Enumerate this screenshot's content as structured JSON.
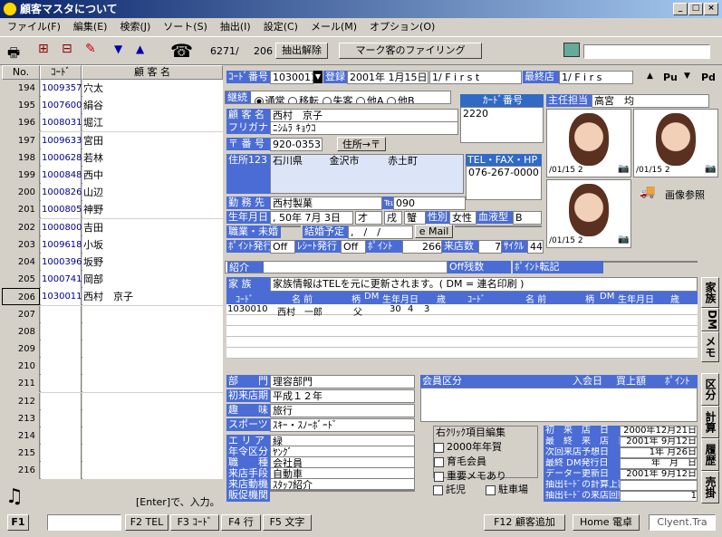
{
  "window": {
    "title": "顧客マスタについて"
  },
  "menu": [
    "ファイル(F)",
    "編集(E)",
    "検索(J)",
    "ソート(S)",
    "抽出(I)",
    "設定(C)",
    "メール(M)",
    "オプション(O)"
  ],
  "toolbar": {
    "count": "6271/",
    "count2": "206",
    "extract_clear": "抽出解除",
    "mark_filing": "マーク客のファイリング"
  },
  "list": {
    "headers": {
      "no": "No.",
      "code": "ｺｰﾄﾞ",
      "name": "顧 客 名"
    },
    "rows": [
      {
        "no": "194",
        "code": "1009357",
        "name": "穴太"
      },
      {
        "no": "195",
        "code": "1007600",
        "name": "絹谷"
      },
      {
        "no": "196",
        "code": "1008031",
        "name": "堀江"
      },
      {
        "no": "197",
        "code": "1009633",
        "name": "宮田"
      },
      {
        "no": "198",
        "code": "1000628",
        "name": "若林"
      },
      {
        "no": "199",
        "code": "1000848",
        "name": "西中"
      },
      {
        "no": "200",
        "code": "1000826",
        "name": "山辺"
      },
      {
        "no": "201",
        "code": "1000805",
        "name": "神野"
      },
      {
        "no": "202",
        "code": "1000800",
        "name": "吉田"
      },
      {
        "no": "203",
        "code": "1009618",
        "name": "小坂"
      },
      {
        "no": "204",
        "code": "1000396",
        "name": "坂野"
      },
      {
        "no": "205",
        "code": "1000741",
        "name": "岡部"
      },
      {
        "no": "206",
        "code": "1030011",
        "name": "西村　京子"
      },
      {
        "no": "207",
        "code": "",
        "name": ""
      },
      {
        "no": "208",
        "code": "",
        "name": ""
      },
      {
        "no": "209",
        "code": "",
        "name": ""
      },
      {
        "no": "210",
        "code": "",
        "name": ""
      },
      {
        "no": "211",
        "code": "",
        "name": ""
      },
      {
        "no": "212",
        "code": "",
        "name": ""
      },
      {
        "no": "213",
        "code": "",
        "name": ""
      },
      {
        "no": "214",
        "code": "",
        "name": ""
      },
      {
        "no": "215",
        "code": "",
        "name": ""
      },
      {
        "no": "216",
        "code": "",
        "name": ""
      }
    ],
    "hint": "[Enter]で、入力。"
  },
  "record": {
    "code_label": "ｺｰﾄﾞ番号",
    "code": "1030011",
    "reg_label": "登録",
    "reg_date": "2001年 1月15日",
    "first1": "1/ F i r s t",
    "last_store_label": "最終店",
    "first2": "1/ F i r s",
    "pu": "Pu",
    "pd": "Pd",
    "status_label": "継続",
    "status_opts": [
      "通常",
      "移転",
      "失客",
      "他A",
      "他B"
    ],
    "card_label": "ｶｰﾄﾞ番号",
    "card": "2220",
    "staff_label": "主任担当",
    "staff": "高宮　均",
    "name_label": "顧 客 名",
    "name": "西村　京子",
    "kana_label": "フリガナ",
    "kana": "ﾆｼﾑﾗ ｷｮｳｺ",
    "zip_label": "〒 番 号",
    "zip": "920-0353",
    "addr_btn": "住所→〒",
    "addr_label": "住所123",
    "addr1": "石川県",
    "addr2": "金沢市",
    "addr3": "赤土町",
    "tel_label": "TEL・FAX・HP",
    "tel": "076-267-0000",
    "work_label": "勤 務 先",
    "work": "西村製菓",
    "work_tel_label": "℡",
    "work_tel": "090",
    "birth_label": "生年月日",
    "birth": ", 50年 7月 3日",
    "age": "才",
    "zodiac": "戌",
    "sign": "蟹",
    "sex_label": "性別",
    "sex": "女性",
    "blood_label": "血液型",
    "blood": "B",
    "job_label": "職業・未婚",
    "wed_label": "結婚予定",
    "wed": ",　/　/",
    "email_label": "e Mail",
    "pt_issue_label": "ﾎﾟｲﾝﾄ発行",
    "pt_issue": "Off",
    "receipt_label": "ﾚｼｰﾄ発行",
    "receipt": "Off",
    "point_label": "ﾎﾟｲﾝﾄ",
    "point": "266",
    "visits_label": "来店数",
    "visits": "7",
    "cycle_label": "ｻｲｸﾙ",
    "cycle": "44",
    "photo_dates": [
      "/01/15 2",
      "/01/15 2",
      "/01/15 2"
    ],
    "photo_ref": "画像参照",
    "intro_label": "紹介",
    "off_label": "Off残数",
    "point_transfer_label": "ﾎﾟｲﾝﾄ転記"
  },
  "family": {
    "label": "家 族",
    "note": "家族情報はTELを元に更新されます。( DM = 連名印刷 )",
    "headers": [
      "ｺｰﾄﾞ",
      "名 前",
      "柄",
      "DM",
      "生年月日",
      "歳",
      "ｺｰﾄﾞ",
      "名 前",
      "柄",
      "DM",
      "生年月日",
      "歳"
    ],
    "row1": {
      "code": "1030010",
      "name": "西村　一郎",
      "rel": "父",
      "y": "30",
      "m": "4",
      "d": "3"
    }
  },
  "tabs_right": [
    "家族",
    "DM",
    "メモ"
  ],
  "tabs_right2": [
    "区分",
    "計算",
    "履歴",
    "売掛"
  ],
  "detail": {
    "dept_label": "部　　門",
    "dept": "理容部門",
    "first_visit_label": "初来店期",
    "first_visit": "平成１２年",
    "hobby_label": "趣　　味",
    "hobby": "旅行",
    "sport_label": "スポーツ",
    "sport": "ｽｷｰ・ｽﾉｰﾎﾞｰﾄﾞ",
    "area_label": "エ リ ア",
    "area": "緑",
    "age_class_label": "年令区分",
    "age_class": "ﾔﾝｸﾞ",
    "job2_label": "職　　種",
    "job2": "会社員",
    "transport_label": "来店手段",
    "transport": "自動車",
    "motive_label": "来店動機",
    "motive": "ｽﾀｯﾌ紹介",
    "reaction_label": "販促機関"
  },
  "member": {
    "label": "会員区分",
    "join_label": "入会日",
    "buy_label": "買上額",
    "point_label": "ﾎﾟｲﾝﾄ"
  },
  "checks": {
    "title": "右ｸﾘｯｸ項目編集",
    "items": [
      "2000年年賀",
      "育毛会員",
      "重要メモあり"
    ],
    "child": "託児",
    "parking": "駐車場"
  },
  "stats": {
    "first_store_label": "初　来　店　日",
    "first_store": "2000年12月21日",
    "last_store_label": "最　終　来　店　日",
    "last_store": "2001年 9月12日",
    "next_label": "次回来店予想日",
    "next": "1年 月26日",
    "last_dm_label": "最終 DM発行日",
    "last_dm": "年　月　日",
    "update_label": "データー更新日",
    "update": "2001年 9月12日",
    "calc_label": "抽出ﾓｰﾄﾞの計算上額",
    "visit_count_label": "抽出ﾓｰﾄﾞの来店回数",
    "visit_count": "1"
  },
  "fkeys": {
    "f1": "F1",
    "f2": "F2 TEL",
    "f3": "F3 ｺｰﾄﾞ",
    "f4": "F4 行",
    "f5": "F5 文字",
    "f12": "F12 顧客追加",
    "home": "Home 電卓",
    "client": "Clyent.Tra"
  }
}
